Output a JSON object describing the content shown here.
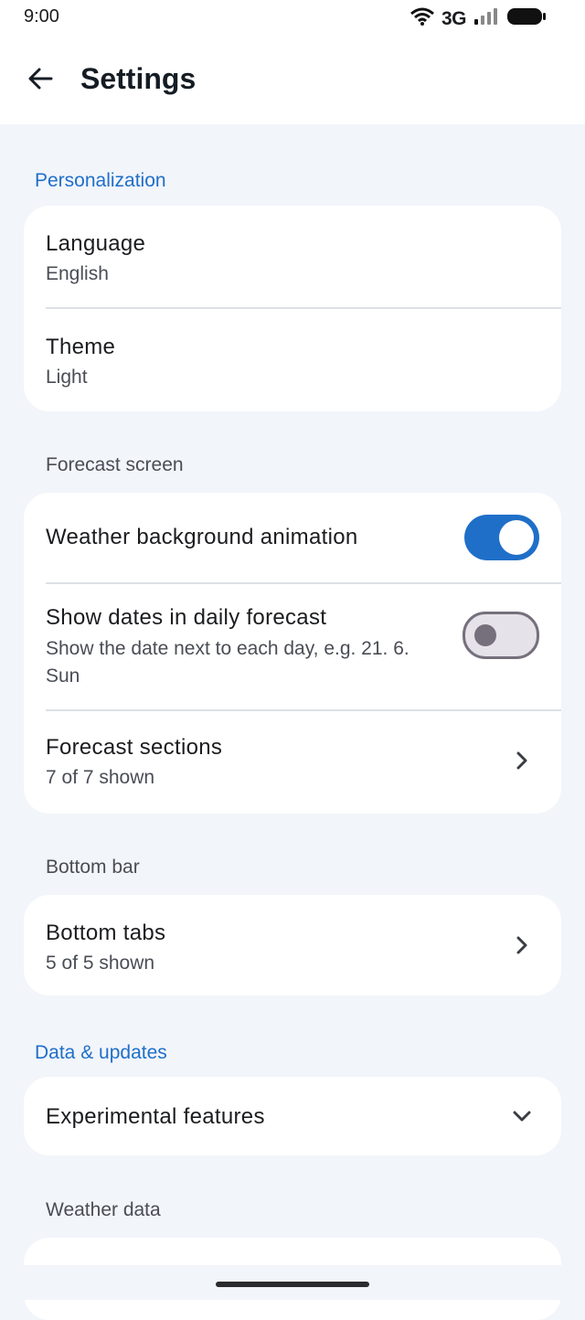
{
  "status_bar": {
    "time": "9:00",
    "network": "3G"
  },
  "app_bar": {
    "title": "Settings"
  },
  "sections": {
    "personalization": "Personalization",
    "forecast_screen": "Forecast screen",
    "bottom_bar": "Bottom bar",
    "data_updates": "Data & updates",
    "weather_data": "Weather data"
  },
  "personalization": {
    "language": {
      "title": "Language",
      "value": "English"
    },
    "theme": {
      "title": "Theme",
      "value": "Light"
    }
  },
  "forecast": {
    "bg_animation": {
      "title": "Weather background animation",
      "enabled": true
    },
    "show_dates": {
      "title": "Show dates in daily forecast",
      "desc_line1": "Show the date next to each day, e.g. 21. 6.",
      "desc_line2": "Sun",
      "enabled": false
    },
    "sections": {
      "title": "Forecast sections",
      "value": "7 of 7 shown"
    }
  },
  "bottom_bar": {
    "tabs": {
      "title": "Bottom tabs",
      "value": "5 of 5 shown"
    }
  },
  "data_updates": {
    "experimental": {
      "title": "Experimental features"
    }
  },
  "colors": {
    "accent": "#1f6fc8",
    "background": "#f2f5fa",
    "card": "#ffffff"
  },
  "icons": {
    "back": "arrow-left-icon",
    "chevron_right": "chevron-right-icon",
    "chevron_down": "chevron-down-icon"
  }
}
